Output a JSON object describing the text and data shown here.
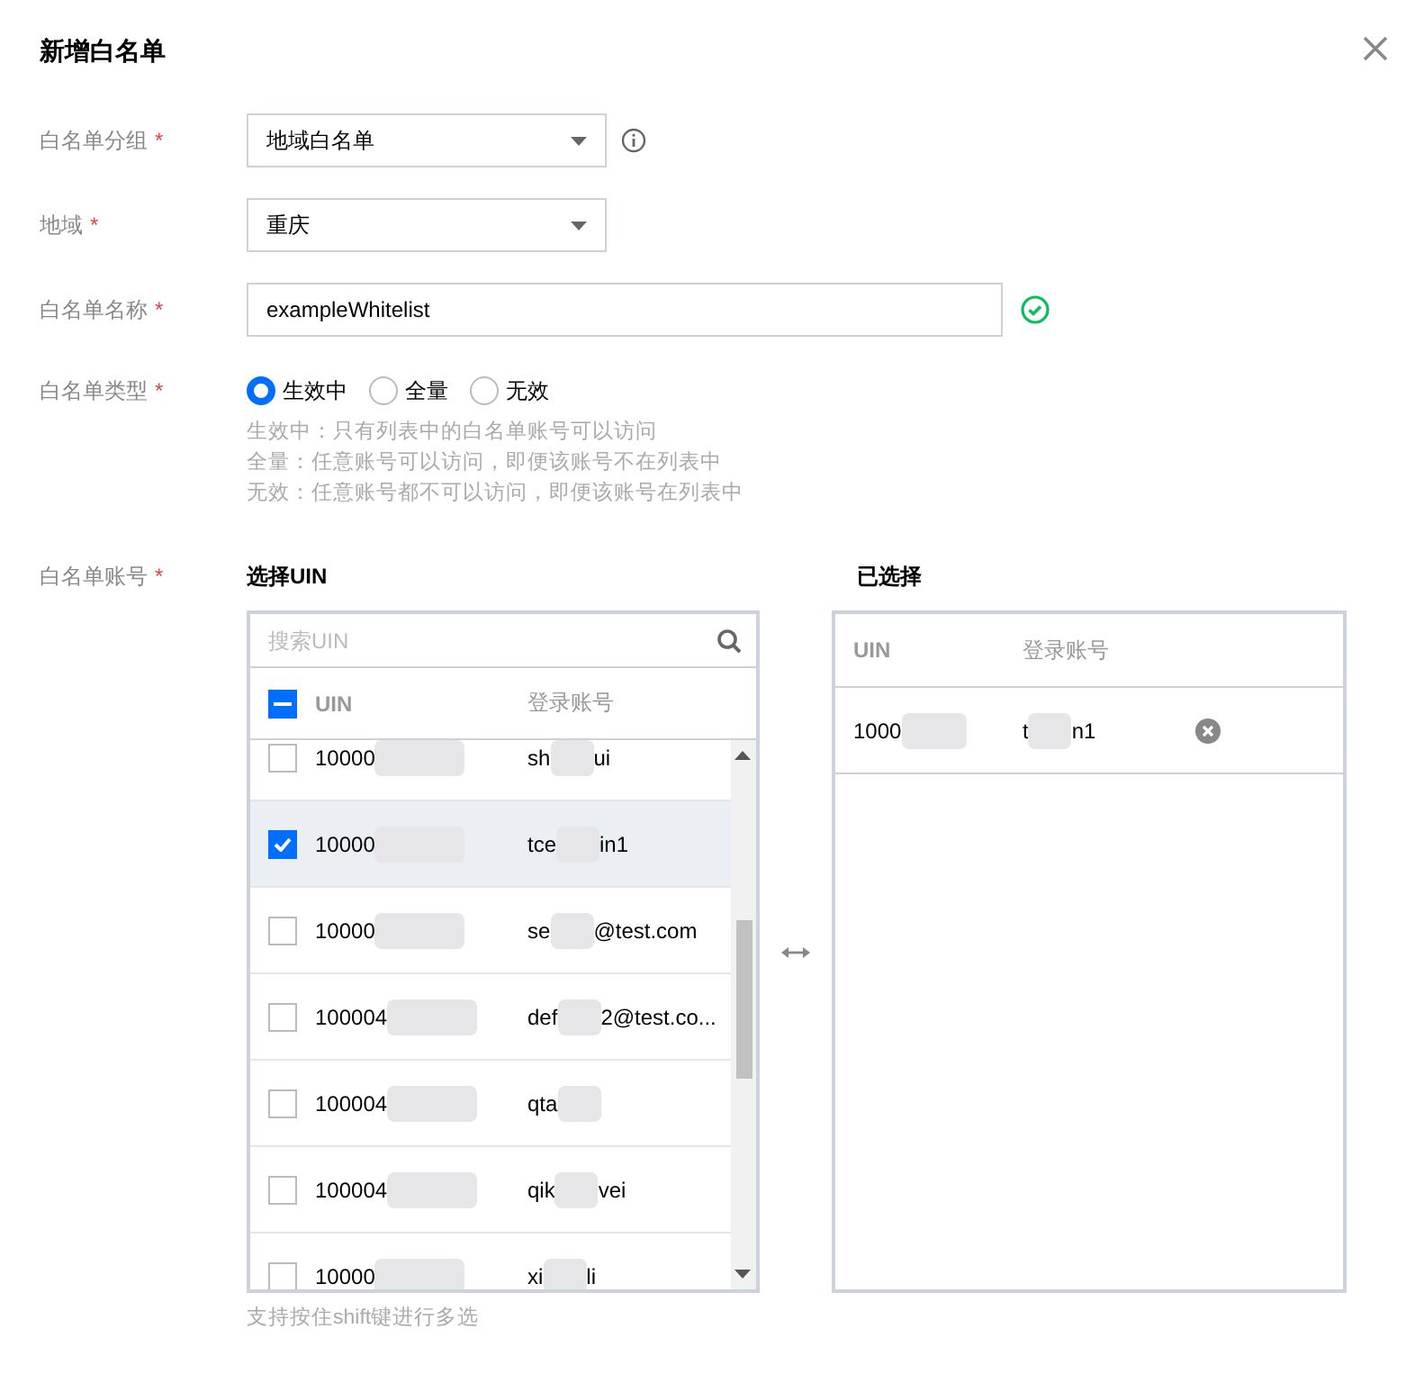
{
  "dialog": {
    "title": "新增白名单"
  },
  "form": [
    {
      "kind": "select",
      "label": "白名单分组",
      "required_mark": "*",
      "value": "地域白名单",
      "info": true
    },
    {
      "kind": "select",
      "label": "地域",
      "required_mark": "*",
      "value": "重庆"
    },
    {
      "kind": "input",
      "label": "白名单名称",
      "required_mark": "*",
      "value": "exampleWhitelist",
      "valid": true
    },
    {
      "kind": "radio",
      "label": "白名单类型",
      "required_mark": "*",
      "options": [
        {
          "label": "生效中",
          "selected": true
        },
        {
          "label": "全量",
          "selected": false
        },
        {
          "label": "无效",
          "selected": false
        }
      ],
      "help": [
        "生效中：只有列表中的白名单账号可以访问",
        "全量：任意账号可以访问，即便该账号不在列表中",
        "无效：任意账号都不可以访问，即便该账号在列表中"
      ]
    }
  ],
  "accounts": {
    "label": "白名单账号",
    "required_mark": "*",
    "source": {
      "title": "选择UIN",
      "search_placeholder": "搜索UIN",
      "columns": [
        "UIN",
        "登录账号"
      ],
      "indeterminate": true,
      "rows": [
        {
          "uin": "10000",
          "account": [
            "sh",
            "ui"
          ],
          "checked": false,
          "selected": false
        },
        {
          "uin": "10000",
          "account": [
            "tce",
            "in1"
          ],
          "checked": true,
          "selected": true
        },
        {
          "uin": "10000",
          "account": [
            "se",
            "@test.com"
          ],
          "checked": false,
          "selected": false
        },
        {
          "uin": "100004",
          "account": [
            "def",
            "2@test.co..."
          ],
          "checked": false,
          "selected": false
        },
        {
          "uin": "100004",
          "account": [
            "qta"
          ],
          "checked": false,
          "selected": false
        },
        {
          "uin": "100004",
          "account": [
            "qik",
            "vei"
          ],
          "checked": false,
          "selected": false
        },
        {
          "uin": "10000",
          "account": [
            "xi",
            "li"
          ],
          "checked": false,
          "selected": false
        }
      ],
      "hint": "支持按住shift键进行多选"
    },
    "target": {
      "title": "已选择",
      "columns": [
        "UIN",
        "登录账号"
      ],
      "rows": [
        {
          "uin": "1000",
          "account": [
            "t",
            "n1"
          ]
        }
      ]
    }
  }
}
